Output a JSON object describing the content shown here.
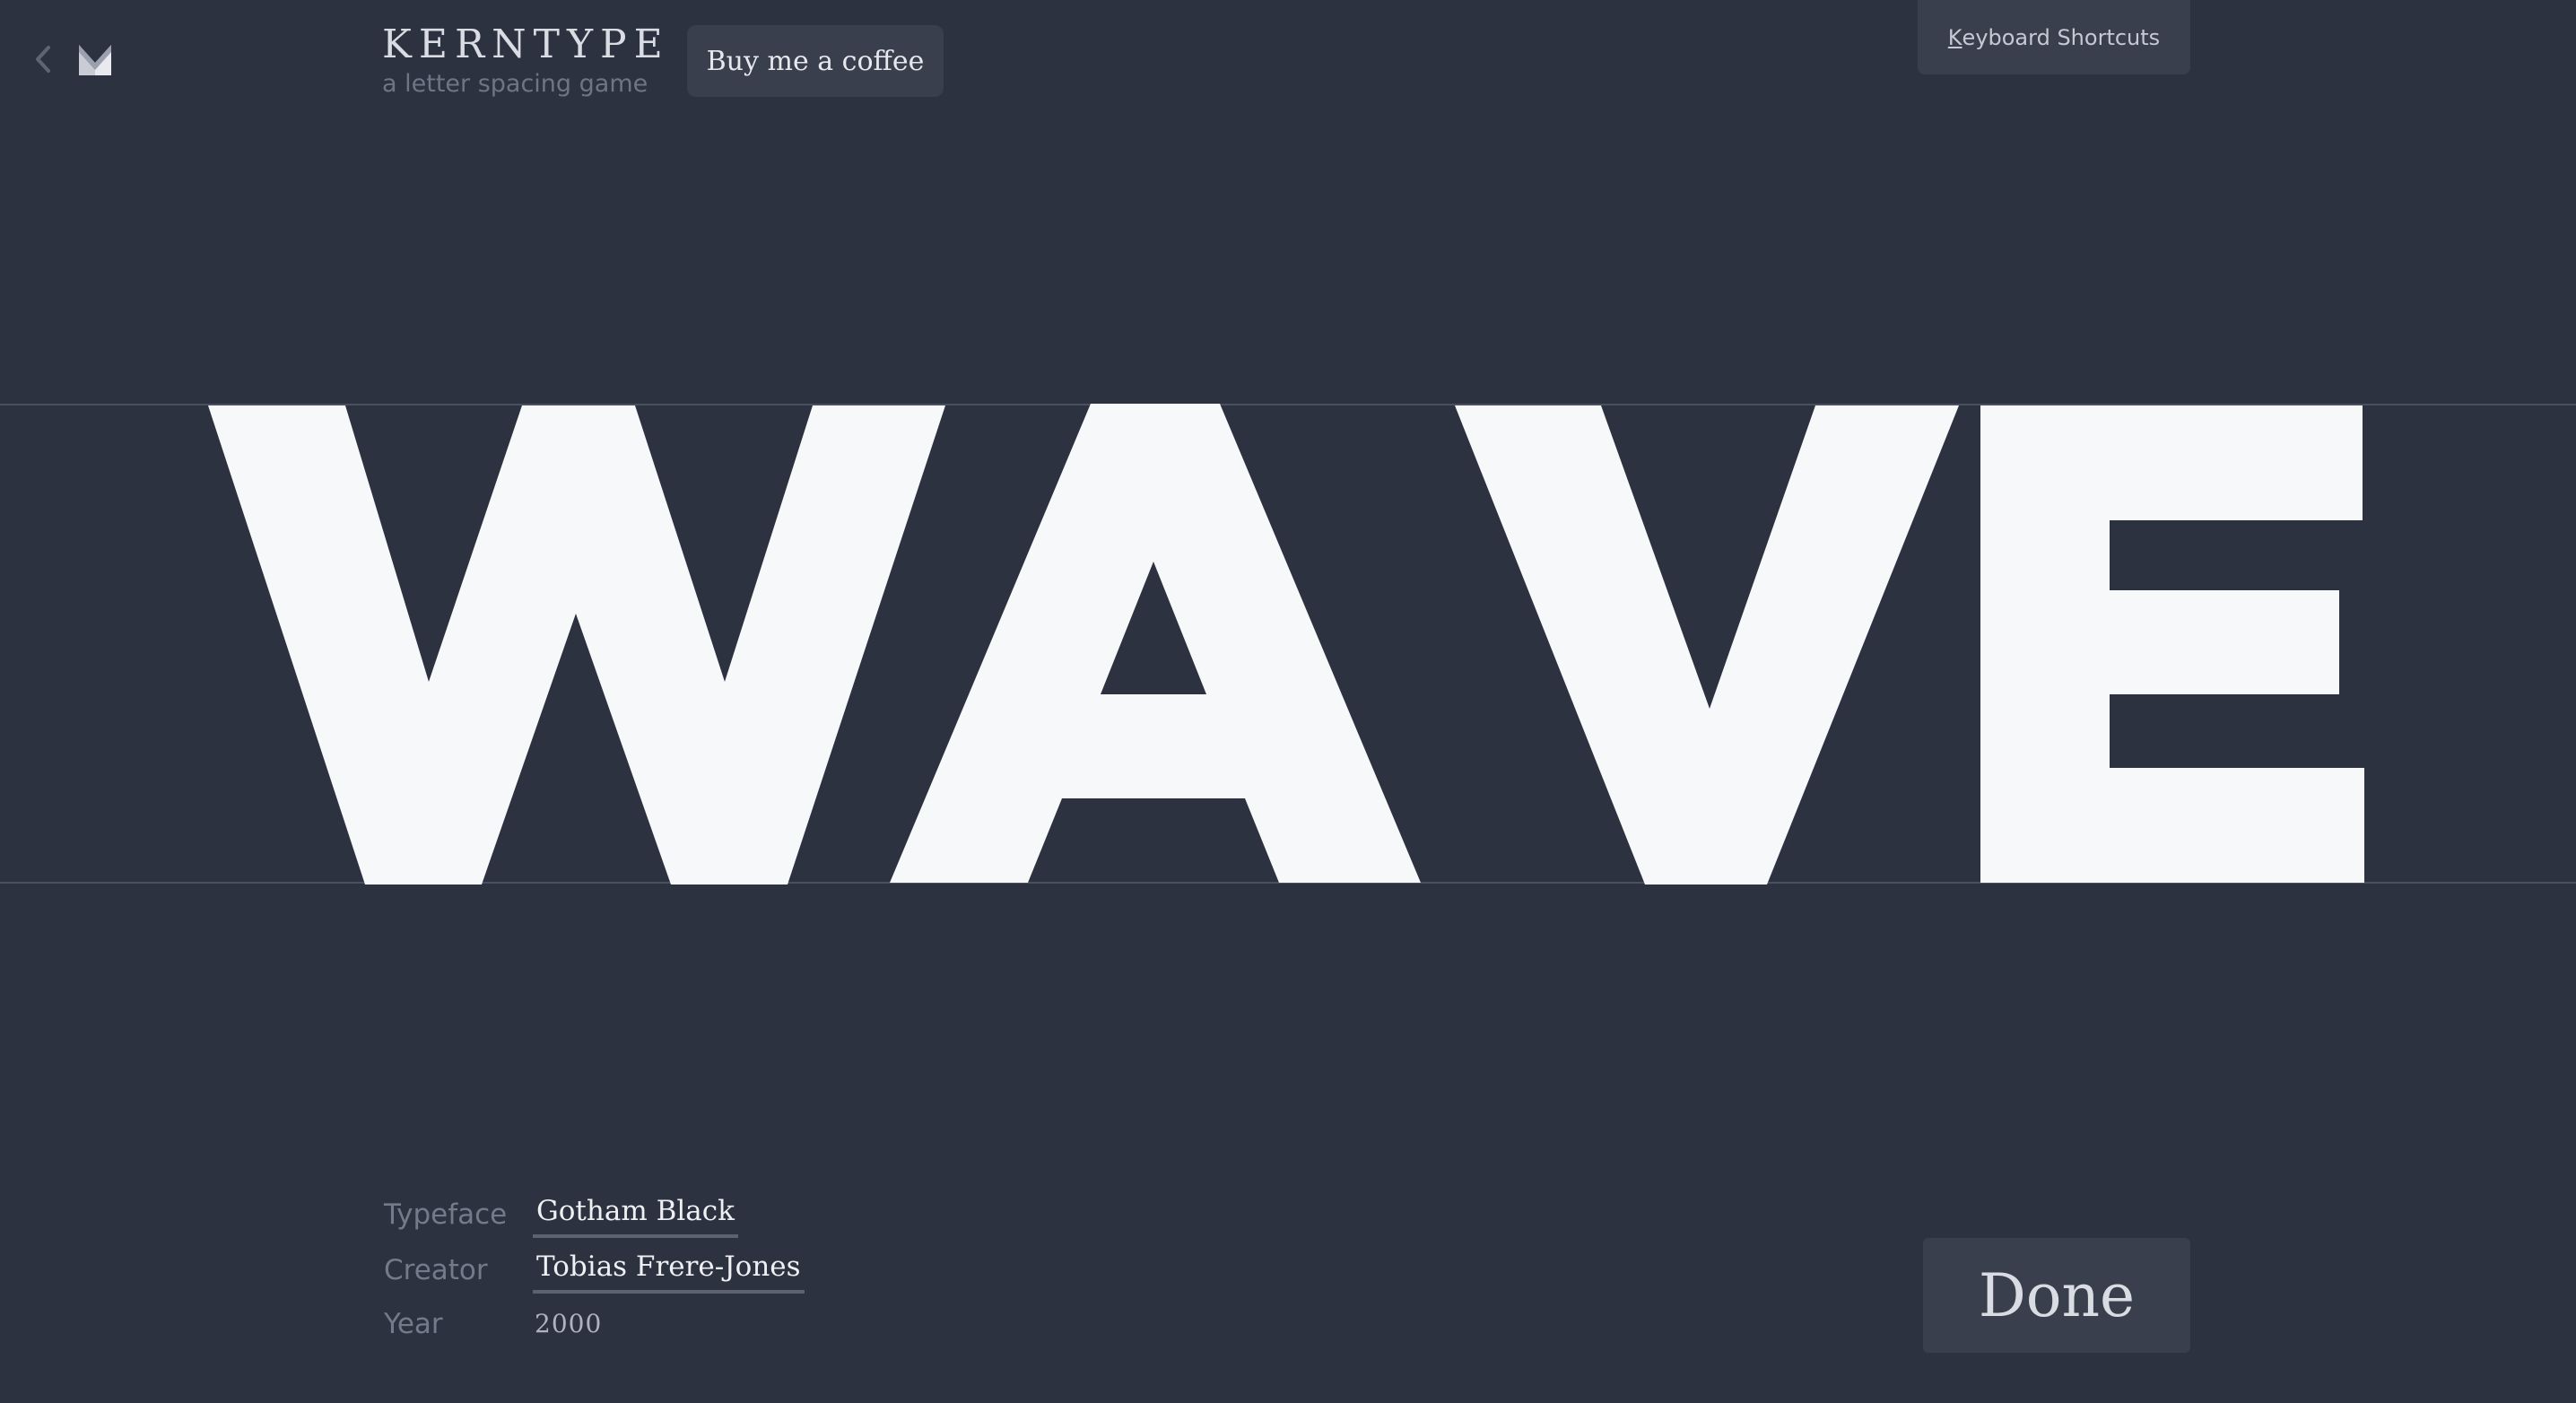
{
  "nav": {
    "back_icon": "chevron-left-icon",
    "logo_icon": "kerntype-logo-icon"
  },
  "brand": {
    "title": "KERNTYPE",
    "subtitle": "a letter spacing game"
  },
  "buttons": {
    "coffee_label": "Buy me a coffee",
    "shortcuts_key": "K",
    "shortcuts_rest": "eyboard Shortcuts",
    "done_label": "Done"
  },
  "word": {
    "text": "WAVE",
    "letters": [
      "W",
      "A",
      "V",
      "E"
    ]
  },
  "meta": {
    "typeface_label": "Typeface",
    "typeface_value": "Gotham Black",
    "creator_label": "Creator",
    "creator_value": "Tobias Frere-Jones",
    "year_label": "Year",
    "year_value": "2000"
  },
  "colors": {
    "background": "#2d3240",
    "glyph": "#f7f8fa",
    "button_bg": "#3a3f4d",
    "guide_line": "#4a505e"
  }
}
